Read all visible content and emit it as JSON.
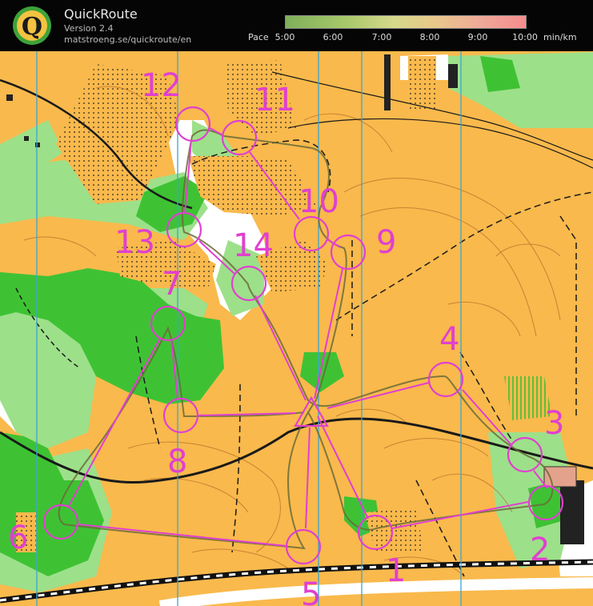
{
  "app": {
    "title": "QuickRoute",
    "version": "Version 2.4",
    "url": "matstroeng.se/quickroute/en",
    "logo_letter": "Q"
  },
  "pace_scale": {
    "label": "Pace",
    "unit": "min/km",
    "ticks": [
      "5:00",
      "6:00",
      "7:00",
      "8:00",
      "9:00",
      "10:00"
    ],
    "colors": {
      "fast": "#7fb05a",
      "slow": "#f48c8c"
    }
  },
  "course": {
    "color": "#e040d0",
    "start_symbol": "start-triangle",
    "controls": [
      {
        "label": "1"
      },
      {
        "label": "2"
      },
      {
        "label": "3"
      },
      {
        "label": "4"
      },
      {
        "label": "5"
      },
      {
        "label": "6"
      },
      {
        "label": "7"
      },
      {
        "label": "8"
      },
      {
        "label": "9"
      },
      {
        "label": "10"
      },
      {
        "label": "11"
      },
      {
        "label": "12"
      },
      {
        "label": "13"
      },
      {
        "label": "14"
      }
    ]
  },
  "map_colors": {
    "open_land": "#f9b94c",
    "forest_green": "#3ec234",
    "light_green": "#9de08a",
    "white_forest": "#ffffff",
    "contour": "#b66a2a",
    "magnetic_north_lines": "#39a6d6",
    "track": "#555555"
  }
}
